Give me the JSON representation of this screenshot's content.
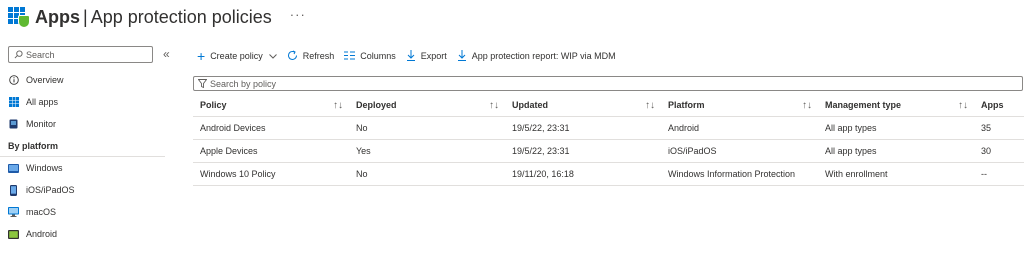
{
  "header": {
    "title_bold": "Apps",
    "title_sep": "|",
    "title_rest": "App protection policies",
    "more": "···"
  },
  "sidebar": {
    "search_placeholder": "Search",
    "collapse": "«",
    "items": [
      {
        "label": "Overview",
        "icon": "info-icon"
      },
      {
        "label": "All apps",
        "icon": "grid-icon"
      },
      {
        "label": "Monitor",
        "icon": "monitor-icon"
      }
    ],
    "section_title": "By platform",
    "platforms": [
      {
        "label": "Windows",
        "icon": "windows-icon"
      },
      {
        "label": "iOS/iPadOS",
        "icon": "phone-icon"
      },
      {
        "label": "macOS",
        "icon": "desktop-icon"
      },
      {
        "label": "Android",
        "icon": "android-icon"
      }
    ]
  },
  "toolbar": {
    "create": "Create policy",
    "refresh": "Refresh",
    "columns": "Columns",
    "export": "Export",
    "report": "App protection report: WIP via MDM"
  },
  "filter": {
    "placeholder": "Search by policy"
  },
  "table": {
    "headers": [
      "Policy",
      "Deployed",
      "Updated",
      "Platform",
      "Management type",
      "Apps"
    ],
    "rows": [
      [
        "Android Devices",
        "No",
        "19/5/22, 23:31",
        "Android",
        "All app types",
        "35"
      ],
      [
        "Apple Devices",
        "Yes",
        "19/5/22, 23:31",
        "iOS/iPadOS",
        "All app types",
        "30"
      ],
      [
        "Windows 10 Policy",
        "No",
        "19/11/20, 16:18",
        "Windows Information Protection",
        "With enrollment",
        "--"
      ]
    ]
  },
  "colors": {
    "accent": "#0078d4",
    "shield": "#5fb932",
    "border": "#e1dfdd",
    "text": "#323130"
  }
}
